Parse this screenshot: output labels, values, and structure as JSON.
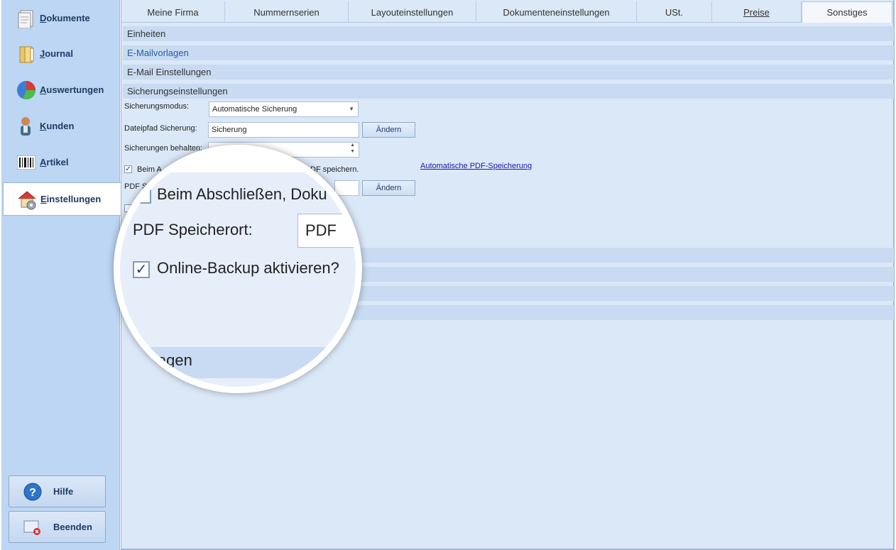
{
  "sidebar": {
    "items": [
      {
        "label": "Dokumente",
        "icon": "document-icon",
        "active": false
      },
      {
        "label": "Journal",
        "icon": "journal-folder-icon",
        "active": false
      },
      {
        "label": "Auswertungen",
        "icon": "pie-chart-icon",
        "active": false
      },
      {
        "label": "Kunden",
        "icon": "customer-person-icon",
        "active": false
      },
      {
        "label": "Artikel",
        "icon": "barcode-icon",
        "active": false
      },
      {
        "label": "Einstellungen",
        "icon": "settings-house-icon",
        "active": true
      }
    ],
    "help_label": "Hilfe",
    "exit_label": "Beenden"
  },
  "tabs": [
    {
      "label": "Meine Firma"
    },
    {
      "label": "Nummernserien"
    },
    {
      "label": "Layouteinstellungen"
    },
    {
      "label": "Dokumenteneinstellungen"
    },
    {
      "label": "USt."
    },
    {
      "label": "Preise"
    },
    {
      "label": "Sonstiges",
      "active": true
    }
  ],
  "sections": {
    "einheiten": "Einheiten",
    "emailvorlagen": "E-Mailvorlagen",
    "emailsettings": "E-Mail Einstellungen",
    "sicherung": "Sicherungseinstellungen"
  },
  "backup": {
    "mode_label": "Sicherungsmodus:",
    "mode_value": "Automatische Sicherung",
    "path_label": "Dateipfad Sicherung:",
    "path_value": "Sicherung",
    "change_label": "Ändern",
    "keep_label": "Sicherungen behalten:",
    "pdf_checkbox_partial_left": "Beim A",
    "pdf_checkbox_partial_right": "DF speichern.",
    "pdf_link": "Automatische PDF-Speicherung",
    "pdf_location_partial": "PDF S",
    "pdf_change_label": "Ändern"
  },
  "magnifier": {
    "checkbox_text": "Beim Abschließen, Doku",
    "pdf_location_label": "PDF Speicherort:",
    "pdf_location_value": "PDF",
    "online_backup_label": "Online-Backup aktivieren?",
    "bottom_partial": "lagen"
  }
}
